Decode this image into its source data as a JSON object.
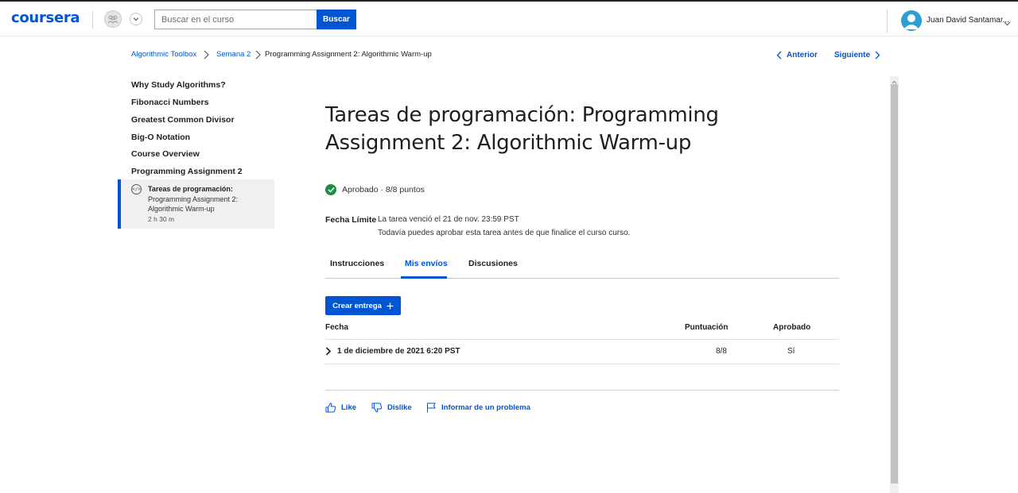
{
  "header": {
    "logo": "coursera",
    "search_placeholder": "Buscar en el curso",
    "search_button": "Buscar",
    "user_name": "Juan David Santamar..."
  },
  "breadcrumb": {
    "items": [
      "Algorithmic Toolbox",
      "Semana 2",
      "Programming Assignment 2: Algorithmic Warm-up"
    ]
  },
  "nav": {
    "prev": "Anterior",
    "next": "Siguiente"
  },
  "sidebar": {
    "items": [
      {
        "label": "Why Study Algorithms?"
      },
      {
        "label": "Fibonacci Numbers"
      },
      {
        "label": "Greatest Common Divisor"
      },
      {
        "label": "Big-O Notation"
      },
      {
        "label": "Course Overview"
      },
      {
        "label": "Programming Assignment 2"
      }
    ],
    "active": {
      "type": "Tareas de programación:",
      "title": "Programming Assignment 2: Algorithmic Warm-up",
      "duration": "2 h 30 m"
    }
  },
  "main": {
    "title": "Tareas de programación: Programming Assignment 2: Algorithmic Warm-up",
    "status": "Aprobado · 8/8 puntos",
    "due_label": "Fecha Límite",
    "due_text": "La tarea venció el 21 de nov. 23:59 PST",
    "due_note": "Todavía puedes aprobar esta tarea antes de que finalice el curso curso.",
    "tabs": [
      {
        "label": "Instrucciones"
      },
      {
        "label": "Mis envíos"
      },
      {
        "label": "Discusiones"
      }
    ],
    "create_button": "Crear entrega",
    "table": {
      "headers": [
        "Fecha",
        "Puntuación",
        "Aprobado"
      ],
      "rows": [
        {
          "date": "1 de diciembre de 2021 6:20 PST",
          "score": "8/8",
          "passed": "Sí"
        }
      ]
    },
    "feedback": {
      "like": "Like",
      "dislike": "Dislike",
      "report": "Informar de un problema"
    }
  },
  "colors": {
    "brand": "#0056d2",
    "success": "#1e8e3e"
  }
}
